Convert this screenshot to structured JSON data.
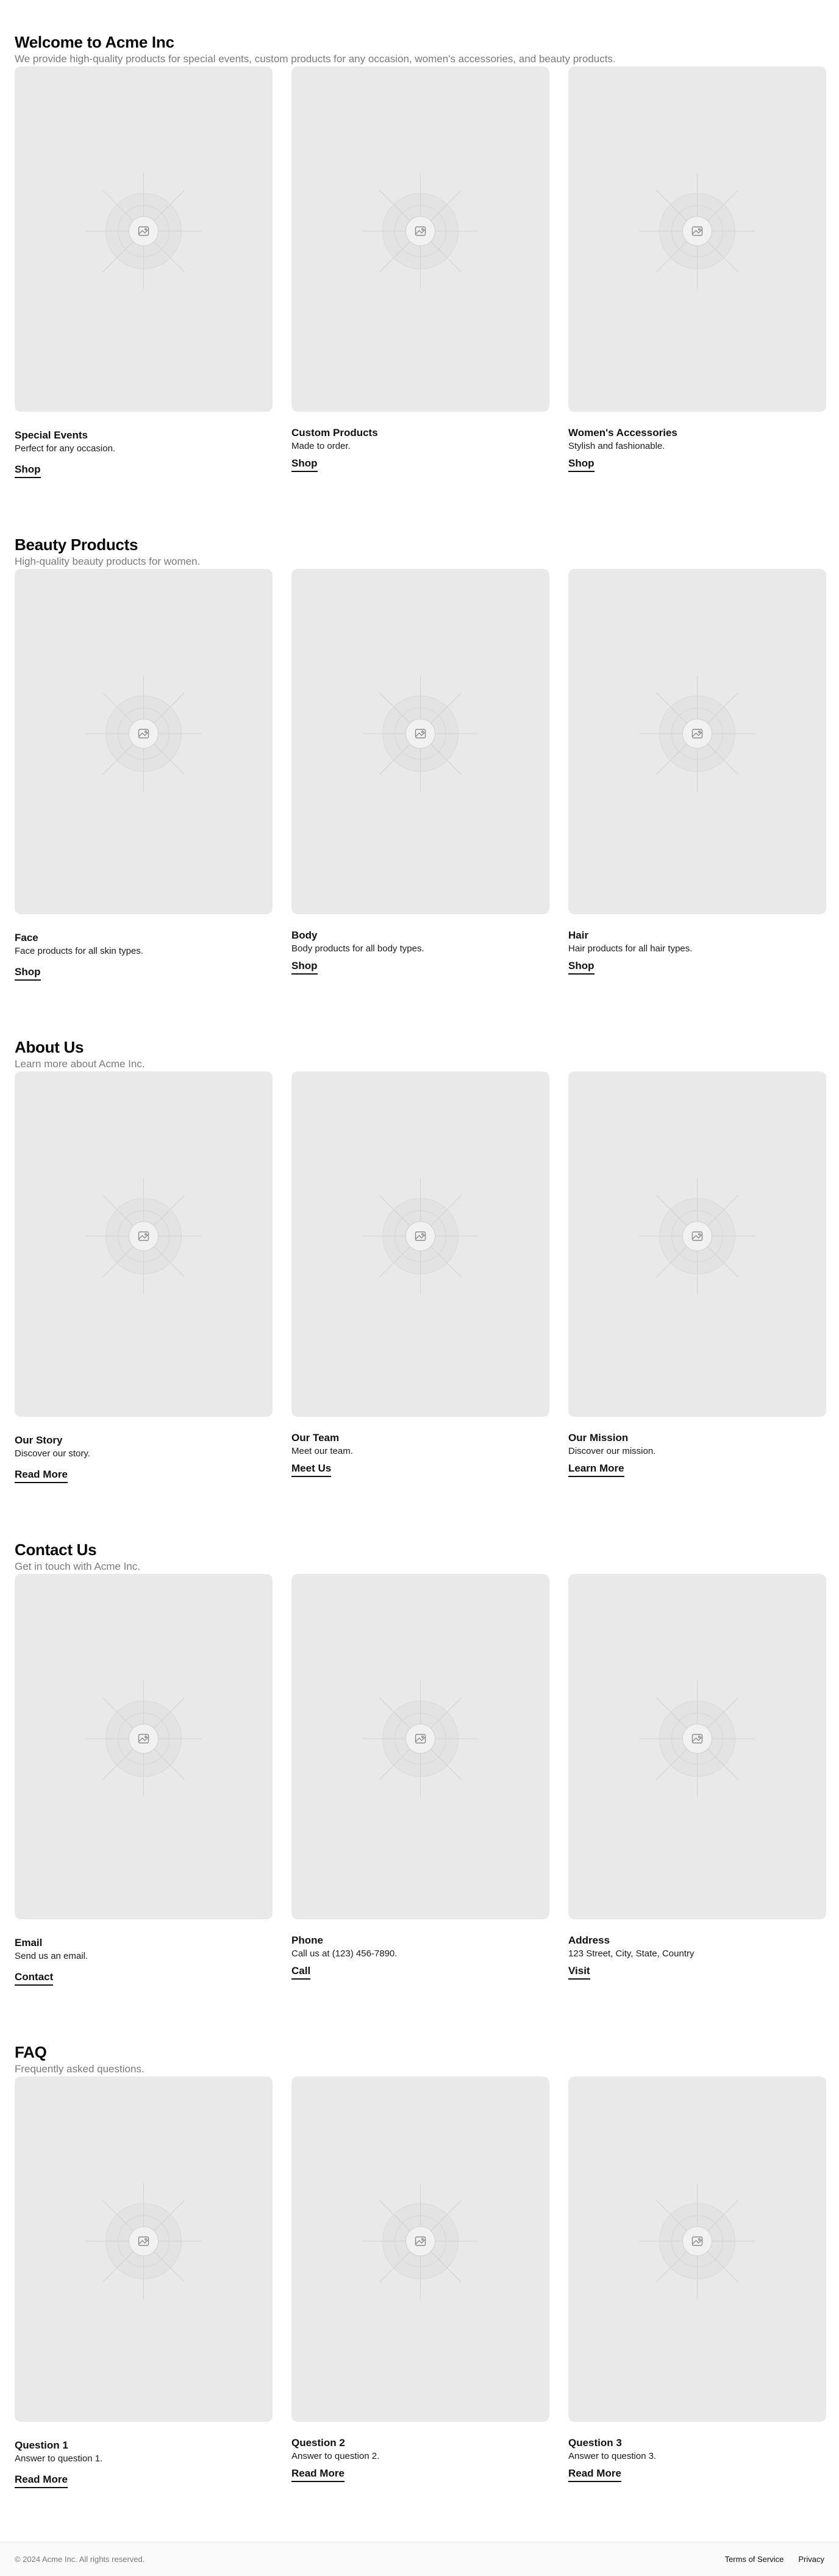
{
  "sections": [
    {
      "title": "Welcome to Acme Inc",
      "subtitle": "We provide high-quality products for special events, custom products for any occasion, women's accessories, and beauty products.",
      "cards": [
        {
          "title": "Special Events",
          "text": "Perfect for any occasion.",
          "link": "Shop"
        },
        {
          "title": "Custom Products",
          "text": "Made to order.",
          "link": "Shop"
        },
        {
          "title": "Women's Accessories",
          "text": "Stylish and fashionable.",
          "link": "Shop"
        }
      ]
    },
    {
      "title": "Beauty Products",
      "subtitle": "High-quality beauty products for women.",
      "cards": [
        {
          "title": "Face",
          "text": "Face products for all skin types.",
          "link": "Shop"
        },
        {
          "title": "Body",
          "text": "Body products for all body types.",
          "link": "Shop"
        },
        {
          "title": "Hair",
          "text": "Hair products for all hair types.",
          "link": "Shop"
        }
      ]
    },
    {
      "title": "About Us",
      "subtitle": "Learn more about Acme Inc.",
      "cards": [
        {
          "title": "Our Story",
          "text": "Discover our story.",
          "link": "Read More"
        },
        {
          "title": "Our Team",
          "text": "Meet our team.",
          "link": "Meet Us"
        },
        {
          "title": "Our Mission",
          "text": "Discover our mission.",
          "link": "Learn More"
        }
      ]
    },
    {
      "title": "Contact Us",
      "subtitle": "Get in touch with Acme Inc.",
      "cards": [
        {
          "title": "Email",
          "text": "Send us an email.",
          "link": "Contact"
        },
        {
          "title": "Phone",
          "text": "Call us at (123) 456-7890.",
          "link": "Call"
        },
        {
          "title": "Address",
          "text": "123 Street, City, State, Country",
          "link": "Visit"
        }
      ]
    },
    {
      "title": "FAQ",
      "subtitle": "Frequently asked questions.",
      "cards": [
        {
          "title": "Question 1",
          "text": "Answer to question 1.",
          "link": "Read More"
        },
        {
          "title": "Question 2",
          "text": "Answer to question 2.",
          "link": "Read More"
        },
        {
          "title": "Question 3",
          "text": "Answer to question 3.",
          "link": "Read More"
        }
      ]
    }
  ],
  "placeholder_icon": "image-placeholder-icon",
  "footer": {
    "copyright": "© 2024 Acme Inc. All rights reserved.",
    "links": [
      "Terms of Service",
      "Privacy"
    ]
  },
  "colors": {
    "background": "#ffffff",
    "placeholder": "#e9e9e9",
    "muted_text": "#7a7a7a",
    "text": "#111111"
  }
}
